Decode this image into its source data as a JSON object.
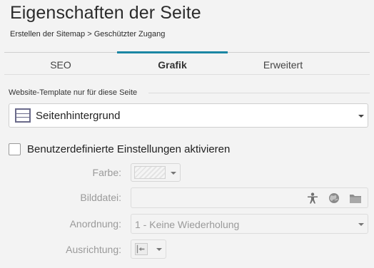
{
  "header": {
    "title": "Eigenschaften der Seite",
    "breadcrumb": "Erstellen der Sitemap > Geschützter Zugang"
  },
  "tabs": [
    {
      "label": "SEO",
      "active": false
    },
    {
      "label": "Grafik",
      "active": true
    },
    {
      "label": "Erweitert",
      "active": false
    }
  ],
  "template_section": {
    "label": "Website-Template nur für diese Seite",
    "selected": "Seitenhintergrund",
    "icon": "page-background-icon"
  },
  "custom_settings": {
    "label": "Benutzerdefinierte Einstellungen aktivieren",
    "checked": false
  },
  "fields": {
    "color": {
      "label": "Farbe:"
    },
    "image": {
      "label": "Bilddatei:",
      "value": "",
      "icons": [
        "person-icon",
        "globe-icon",
        "folder-icon"
      ]
    },
    "arrangement": {
      "label": "Anordnung:",
      "value": "1 - Keine Wiederholung"
    },
    "alignment": {
      "label": "Ausrichtung:",
      "icon": "align-left-icon"
    }
  },
  "colors": {
    "accent": "#1a86a3",
    "disabled_text": "#9a9a9a",
    "background": "#f3f3f3"
  }
}
